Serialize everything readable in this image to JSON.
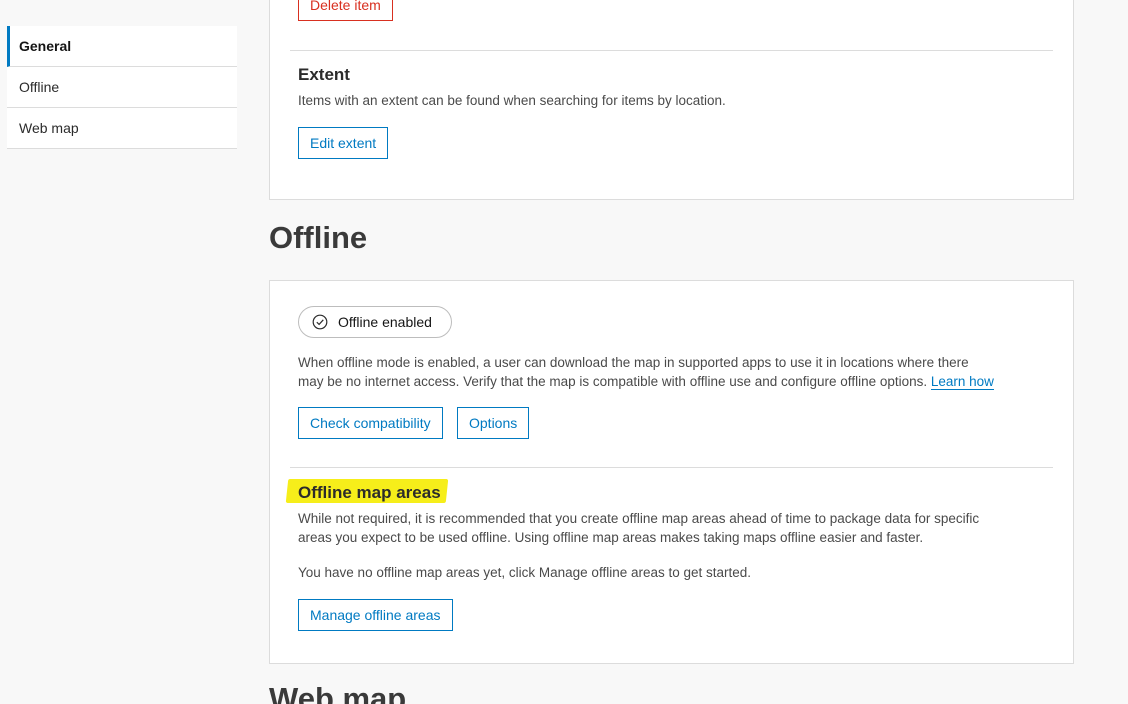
{
  "sidebar": {
    "items": [
      {
        "label": "General",
        "active": true
      },
      {
        "label": "Offline",
        "active": false
      },
      {
        "label": "Web map",
        "active": false
      }
    ]
  },
  "top_panel": {
    "delete_button": "Delete item",
    "extent": {
      "title": "Extent",
      "description": "Items with an extent can be found when searching for items by location.",
      "edit_button": "Edit extent"
    }
  },
  "offline": {
    "section_title": "Offline",
    "chip_label": "Offline enabled",
    "chip_icon": "check-circle-icon",
    "description_line1": "When offline mode is enabled, a user can download the map in supported apps to use it in locations where there",
    "description_line2": "may be no internet access. Verify that the map is compatible with offline use and configure offline options.",
    "learn_how": "Learn how",
    "check_button": "Check compatibility",
    "options_button": "Options",
    "areas": {
      "title": "Offline map areas",
      "description_line1": "While not required, it is recommended that you create offline map areas ahead of time to package data for specific",
      "description_line2": "areas you expect to be used offline. Using offline map areas makes taking maps offline easier and faster.",
      "empty_text": "You have no offline map areas yet, click Manage offline areas to get started.",
      "manage_button": "Manage offline areas"
    }
  },
  "webmap": {
    "section_title": "Web map"
  },
  "colors": {
    "accent": "#007ac2",
    "danger": "#d83020",
    "highlight": "#f6ee1a"
  }
}
